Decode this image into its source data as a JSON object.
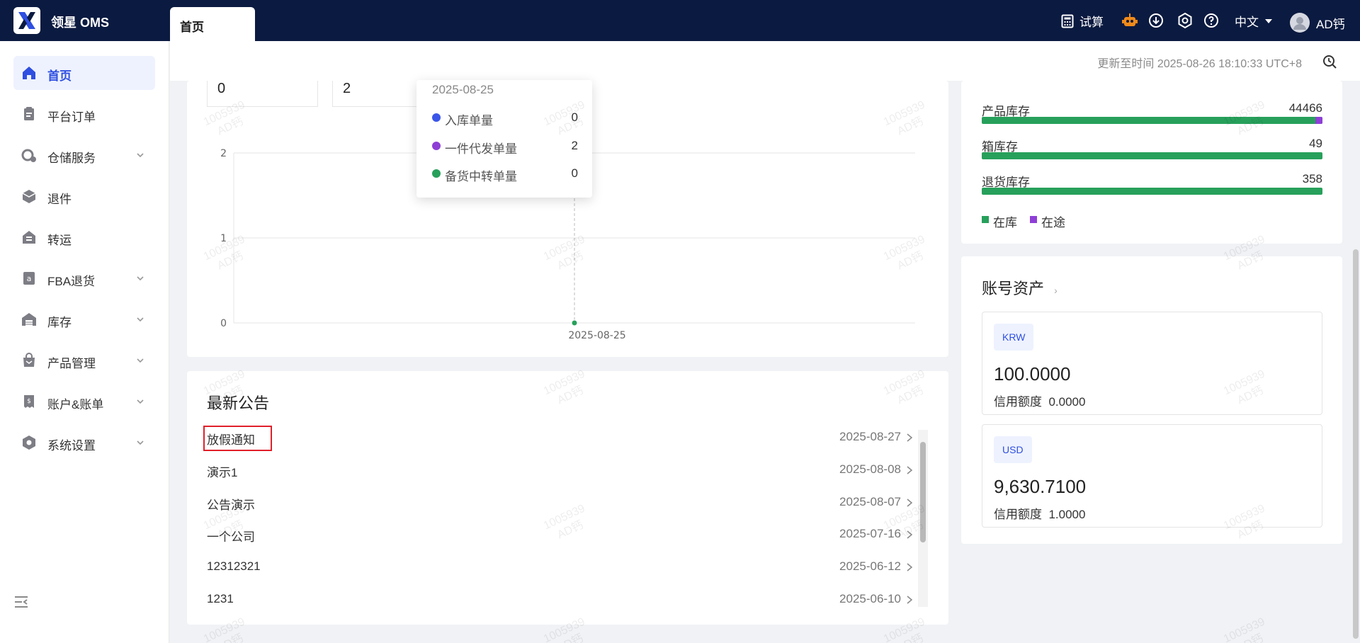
{
  "app": {
    "title": "领星 OMS"
  },
  "tabs": [
    {
      "label": "首页"
    }
  ],
  "header": {
    "calc_label": "试算",
    "language": "中文",
    "user_name": "AD钙"
  },
  "sidebar": {
    "items": [
      {
        "label": "首页",
        "icon": "home-icon",
        "active": true
      },
      {
        "label": "平台订单",
        "icon": "clipboard-icon"
      },
      {
        "label": "仓储服务",
        "icon": "warehouse-service-icon",
        "expandable": true
      },
      {
        "label": "退件",
        "icon": "return-box-icon"
      },
      {
        "label": "转运",
        "icon": "transfer-icon"
      },
      {
        "label": "FBA退货",
        "icon": "amazon-icon",
        "expandable": true
      },
      {
        "label": "库存",
        "icon": "warehouse-icon",
        "expandable": true
      },
      {
        "label": "产品管理",
        "icon": "bag-icon",
        "expandable": true
      },
      {
        "label": "账户&账单",
        "icon": "bill-icon",
        "expandable": true
      },
      {
        "label": "系统设置",
        "icon": "hex-gear-icon",
        "expandable": true
      }
    ]
  },
  "main": {
    "update_text": "更新至时间 2025-08-26 18:10:33 UTC+8",
    "stats": [
      {
        "value": "0"
      },
      {
        "value": "2"
      }
    ],
    "order_chart": {
      "y_ticks": [
        "0",
        "1",
        "2"
      ],
      "x_ticks": [
        "2025-08-25"
      ],
      "tooltip": {
        "date": "2025-08-25",
        "rows": [
          {
            "name": "入库单量",
            "value": "0",
            "color": "#3a56e8"
          },
          {
            "name": "一件代发单量",
            "value": "2",
            "color": "#8e3fd6"
          },
          {
            "name": "备货中转单量",
            "value": "0",
            "color": "#27a05b"
          }
        ]
      }
    },
    "chart_data": {
      "type": "line",
      "x": [
        "2025-08-25"
      ],
      "series": [
        {
          "name": "入库单量",
          "values": [
            0
          ]
        },
        {
          "name": "一件代发单量",
          "values": [
            2
          ]
        },
        {
          "name": "备货中转单量",
          "values": [
            0
          ]
        }
      ],
      "ylim": [
        0,
        2
      ]
    },
    "notices": {
      "title": "最新公告",
      "items": [
        {
          "name": "放假通知",
          "date": "2025-08-27"
        },
        {
          "name": "演示1",
          "date": "2025-08-08"
        },
        {
          "name": "公告演示",
          "date": "2025-08-07"
        },
        {
          "name": "一个公司",
          "date": "2025-07-16"
        },
        {
          "name": "12312321",
          "date": "2025-06-12"
        },
        {
          "name": "1231",
          "date": "2025-06-10"
        }
      ]
    }
  },
  "inventory": {
    "rows": [
      {
        "name": "产品库存",
        "value": "44466",
        "transit_fraction": 0.02
      },
      {
        "name": "箱库存",
        "value": "49",
        "transit_fraction": 0
      },
      {
        "name": "退货库存",
        "value": "358",
        "transit_fraction": 0
      }
    ],
    "legend": [
      {
        "label": "在库",
        "color": "#27a05b"
      },
      {
        "label": "在途",
        "color": "#8e3fd6"
      }
    ]
  },
  "assets": {
    "title": "账号资产",
    "accounts": [
      {
        "currency": "KRW",
        "amount": "100.0000",
        "credit_label": "信用额度",
        "credit_value": "0.0000"
      },
      {
        "currency": "USD",
        "amount": "9,630.7100",
        "credit_label": "信用额度",
        "credit_value": "1.0000"
      }
    ]
  },
  "watermark": {
    "line1": "1005939",
    "line2": "AD钙"
  }
}
